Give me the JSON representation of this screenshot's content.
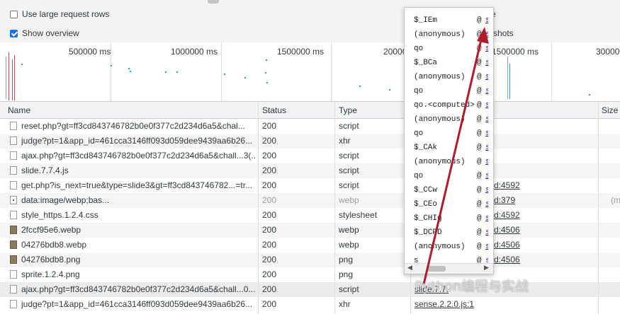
{
  "options": {
    "large_rows_label": "Use large request rows",
    "large_rows_checked": false,
    "overview_label": "Show overview",
    "overview_checked": true,
    "right_top_text": "e",
    "screenshots_label": "shots"
  },
  "overview": {
    "ticks": [
      "500000 ms",
      "1000000 ms",
      "1500000 ms",
      "20000",
      "1500000 ms",
      "300000"
    ]
  },
  "table": {
    "headers": {
      "name": "Name",
      "status": "Status",
      "type": "Type",
      "size": "Size"
    },
    "rows": [
      {
        "name": "reset.php?gt=ff3cd843746782b0e0f377c2d234d6a5&chal...",
        "status": "200",
        "type": "script",
        "initiator": "",
        "size": "",
        "icon": "doc"
      },
      {
        "name": "judge?pt=1&app_id=461cca3146ff093d059dee9439aa6b26...",
        "status": "200",
        "type": "xhr",
        "initiator": "",
        "size": "",
        "icon": "doc"
      },
      {
        "name": "ajax.php?gt=ff3cd843746782b0e0f377c2d234d6a5&chall...3(...",
        "status": "200",
        "type": "script",
        "initiator": "",
        "size": "",
        "icon": "doc"
      },
      {
        "name": "slide.7.7.4.js",
        "status": "200",
        "type": "script",
        "initiator": "",
        "size": "",
        "icon": "doc"
      },
      {
        "name": "get.php?is_next=true&type=slide3&gt=ff3cd843746782...=tr...",
        "status": "200",
        "type": "script",
        "initiator": "d:4592",
        "size": "",
        "icon": "doc"
      },
      {
        "name": "data:image/webp;bas...",
        "status": "200",
        "type": "webp",
        "initiator": "d:379",
        "size": "(m",
        "icon": "webp"
      },
      {
        "name": "style_https.1.2.4.css",
        "status": "200",
        "type": "stylesheet",
        "initiator": "d:4592",
        "size": "",
        "icon": "doc"
      },
      {
        "name": "2fccf95e6.webp",
        "status": "200",
        "type": "webp",
        "initiator": "d:4506",
        "size": "",
        "icon": "img"
      },
      {
        "name": "04276bdb8.webp",
        "status": "200",
        "type": "webp",
        "initiator": "d:4506",
        "size": "",
        "icon": "img"
      },
      {
        "name": "04276bdb8.png",
        "status": "200",
        "type": "png",
        "initiator": "d:4506",
        "size": "",
        "icon": "img"
      },
      {
        "name": "sprite.1.2.4.png",
        "status": "200",
        "type": "png",
        "initiator": "",
        "size": "",
        "icon": "doc"
      },
      {
        "name": "ajax.php?gt=ff3cd843746782b0e0f377c2d234d6a5&chall...0...",
        "status": "200",
        "type": "script",
        "initiator": "slide.7.7.",
        "size": "",
        "icon": "doc"
      },
      {
        "name": "judge?pt=1&app_id=461cca3146ff093d059dee9439aa6b26...",
        "status": "200",
        "type": "xhr",
        "initiator": "sense.2.2.0.js:1",
        "size": "",
        "icon": "doc"
      }
    ]
  },
  "callstack": {
    "frames": [
      {
        "fn": "$_IEm",
        "loc": "s"
      },
      {
        "fn": "(anonymous)",
        "loc": "s"
      },
      {
        "fn": "qo",
        "loc": "s"
      },
      {
        "fn": "$_BCa",
        "loc": "s"
      },
      {
        "fn": "(anonymous)",
        "loc": "s"
      },
      {
        "fn": "qo",
        "loc": "s"
      },
      {
        "fn": "qo.<computed>",
        "loc": "s"
      },
      {
        "fn": "(anonymous)",
        "loc": "s"
      },
      {
        "fn": "qo",
        "loc": "s"
      },
      {
        "fn": "$_CAk",
        "loc": "s"
      },
      {
        "fn": "(anonymous)",
        "loc": "s"
      },
      {
        "fn": "qo",
        "loc": "s"
      },
      {
        "fn": "$_CCw",
        "loc": "s"
      },
      {
        "fn": "$_CEo",
        "loc": "s"
      },
      {
        "fn": "$_CHIg",
        "loc": "s"
      },
      {
        "fn": "$_DCPD",
        "loc": "s"
      },
      {
        "fn": "(anonymous)",
        "loc": "s"
      },
      {
        "fn": "s",
        "loc": "s"
      }
    ],
    "at_symbol": "@"
  },
  "watermark": "Python编程与实战",
  "colors": {
    "arrow": "#b01c2e",
    "accent": "#1a73e8"
  }
}
